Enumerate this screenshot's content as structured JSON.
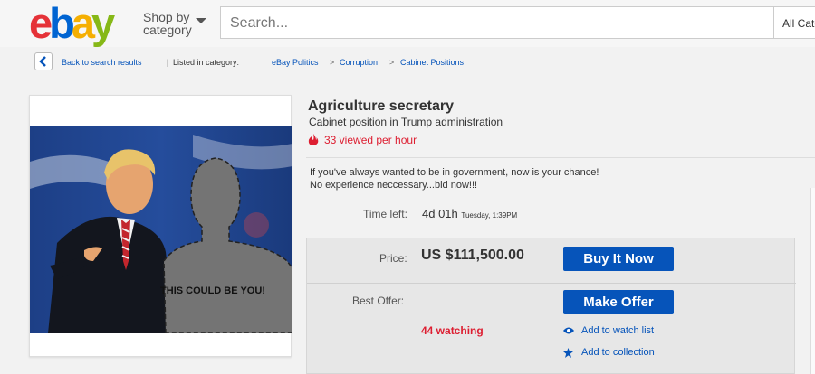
{
  "header": {
    "logo": {
      "letters": [
        "e",
        "b",
        "a",
        "y"
      ],
      "colors": [
        "#e53238",
        "#0064d2",
        "#f5af02",
        "#86b817"
      ]
    },
    "shop_by": [
      "Shop by",
      "category"
    ],
    "search_placeholder": "Search...",
    "category_select": "All Categories"
  },
  "breadcrumb": {
    "back": "Back to search results",
    "separator": "|",
    "listed": "Listed in category:",
    "categories": [
      "eBay Politics",
      "Corruption",
      "Cabinet Positions"
    ]
  },
  "photo": {
    "caption": "THIS COULD BE YOU!"
  },
  "item": {
    "title": "Agriculture secretary",
    "subtitle": "Cabinet position in Trump administration",
    "viewed": "33 viewed per hour",
    "description": [
      "If you've always wanted to be in government, now is your chance!",
      "No experience neccessary...bid now!!!"
    ],
    "time_left_label": "Time left:",
    "time_left_value": "4d 01h",
    "time_left_detail": "Tuesday, 1:39PM",
    "price_label": "Price:",
    "price_value": "US $111,500.00",
    "buy_now": "Buy It Now",
    "best_offer_label": "Best Offer:",
    "make_offer": "Make Offer",
    "watching": "44 watching",
    "add_watch": "Add to watch list",
    "add_collection": "Add to collection"
  },
  "colors": {
    "link": "#0654ba",
    "alert": "#dd1e31",
    "button": "#0654ba"
  }
}
